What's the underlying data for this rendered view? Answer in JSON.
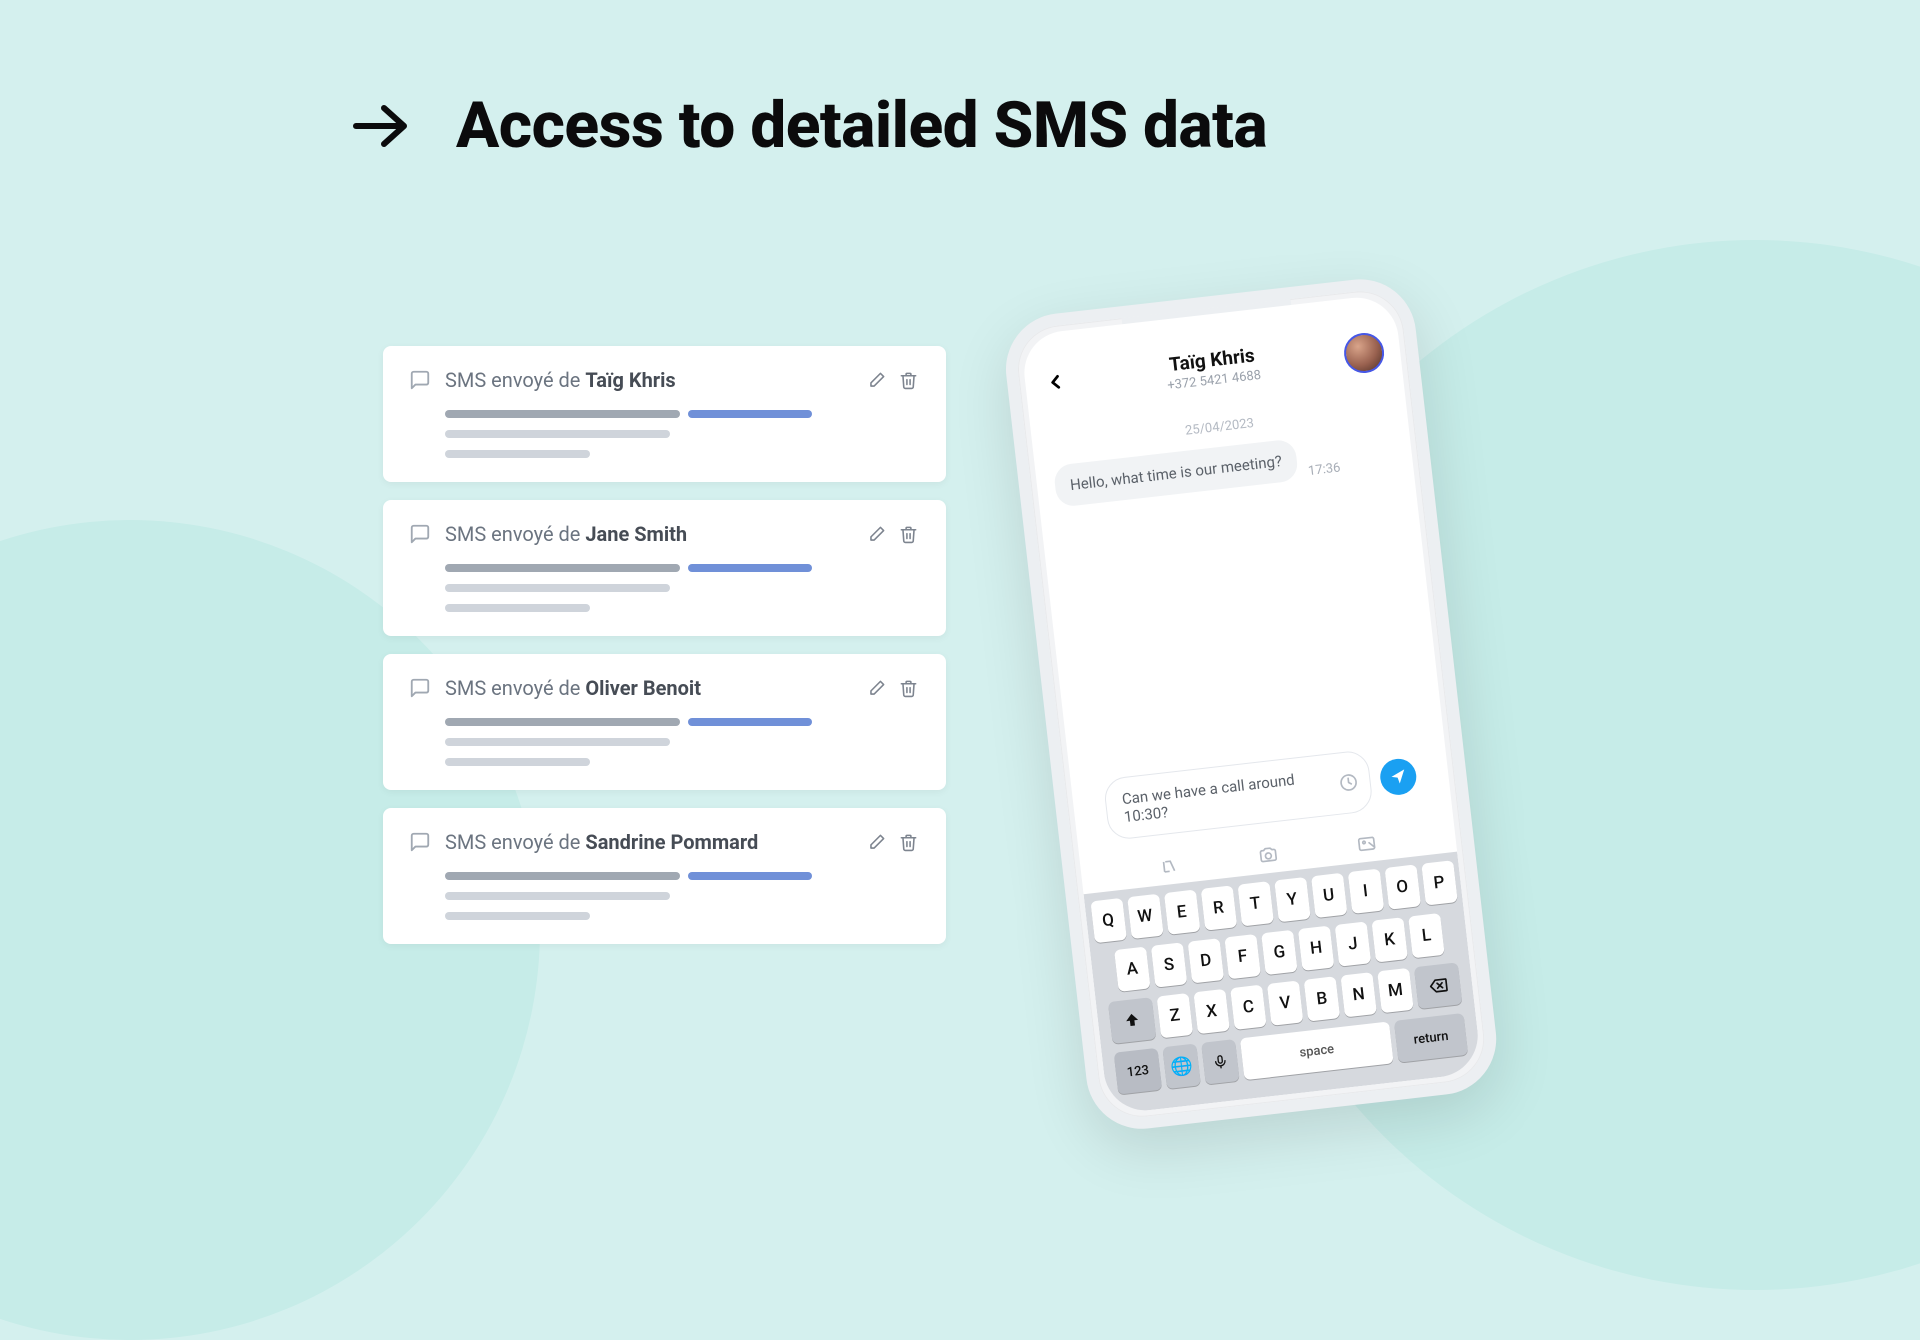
{
  "heading": "Access to detailed SMS data",
  "cards": [
    {
      "prefix": "SMS envoyé de ",
      "name": "Taïg Khris"
    },
    {
      "prefix": "SMS envoyé de ",
      "name": "Jane Smith"
    },
    {
      "prefix": "SMS envoyé de ",
      "name": "Oliver Benoit"
    },
    {
      "prefix": "SMS envoyé de ",
      "name": "Sandrine Pommard"
    }
  ],
  "phone": {
    "contact": {
      "name": "Taïg Khris",
      "number": "+372 5421 4688"
    },
    "date": "25/04/2023",
    "message": {
      "text": "Hello, what time is our meeting?",
      "time": "17:36"
    },
    "compose": "Can we have a call around 10:30?",
    "keyboard": {
      "row1": [
        "Q",
        "W",
        "E",
        "R",
        "T",
        "Y",
        "U",
        "I",
        "O",
        "P"
      ],
      "row2": [
        "A",
        "S",
        "D",
        "F",
        "G",
        "H",
        "J",
        "K",
        "L"
      ],
      "row3": [
        "Z",
        "X",
        "C",
        "V",
        "B",
        "N",
        "M"
      ],
      "fn123": "123",
      "space": "space",
      "ret": "return"
    }
  }
}
